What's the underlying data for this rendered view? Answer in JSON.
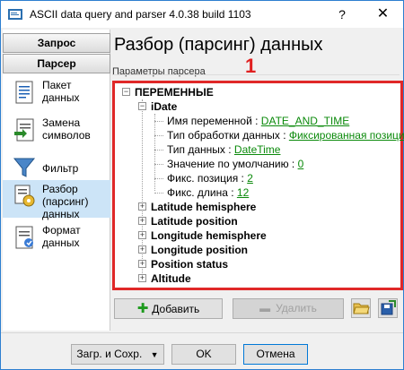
{
  "window": {
    "title": "ASCII data query and parser 4.0.38 build 1103",
    "help": "?",
    "close": "✕"
  },
  "sidebar": {
    "buttons": [
      {
        "label": "Запрос"
      },
      {
        "label": "Парсер"
      }
    ],
    "items": [
      {
        "label": "Пакет данных",
        "icon": "document-icon"
      },
      {
        "label": "Замена символов",
        "icon": "replace-icon"
      },
      {
        "label": "Фильтр",
        "icon": "filter-icon"
      },
      {
        "label": "Разбор (парсинг) данных",
        "icon": "parser-icon",
        "selected": true
      },
      {
        "label": "Формат данных",
        "icon": "format-icon"
      }
    ]
  },
  "main": {
    "title": "Разбор (парсинг) данных",
    "annotation_number": "1",
    "group_label": "Параметры парсера",
    "tree": {
      "root": "ПЕРЕМЕННЫЕ",
      "expanded_item": "iDate",
      "props": [
        {
          "label": "Имя переменной : ",
          "value": "DATE_AND_TIME"
        },
        {
          "label": "Тип обработки данных : ",
          "value": "Фиксированная позиция"
        },
        {
          "label": "Тип данных : ",
          "value": "DateTime"
        },
        {
          "label": "Значение по умолчанию : ",
          "value": "0"
        },
        {
          "label": "Фикс. позиция : ",
          "value": "2"
        },
        {
          "label": "Фикс. длина : ",
          "value": "12"
        }
      ],
      "collapsed_items": [
        "Latitude hemisphere",
        "Latitude position",
        "Longitude hemisphere",
        "Longitude position",
        "Position status",
        "Altitude"
      ]
    },
    "add_button": "Добавить",
    "remove_button": "Удалить"
  },
  "footer": {
    "load_save": "Загр. и Сохр.",
    "ok": "OK",
    "cancel": "Отмена"
  }
}
